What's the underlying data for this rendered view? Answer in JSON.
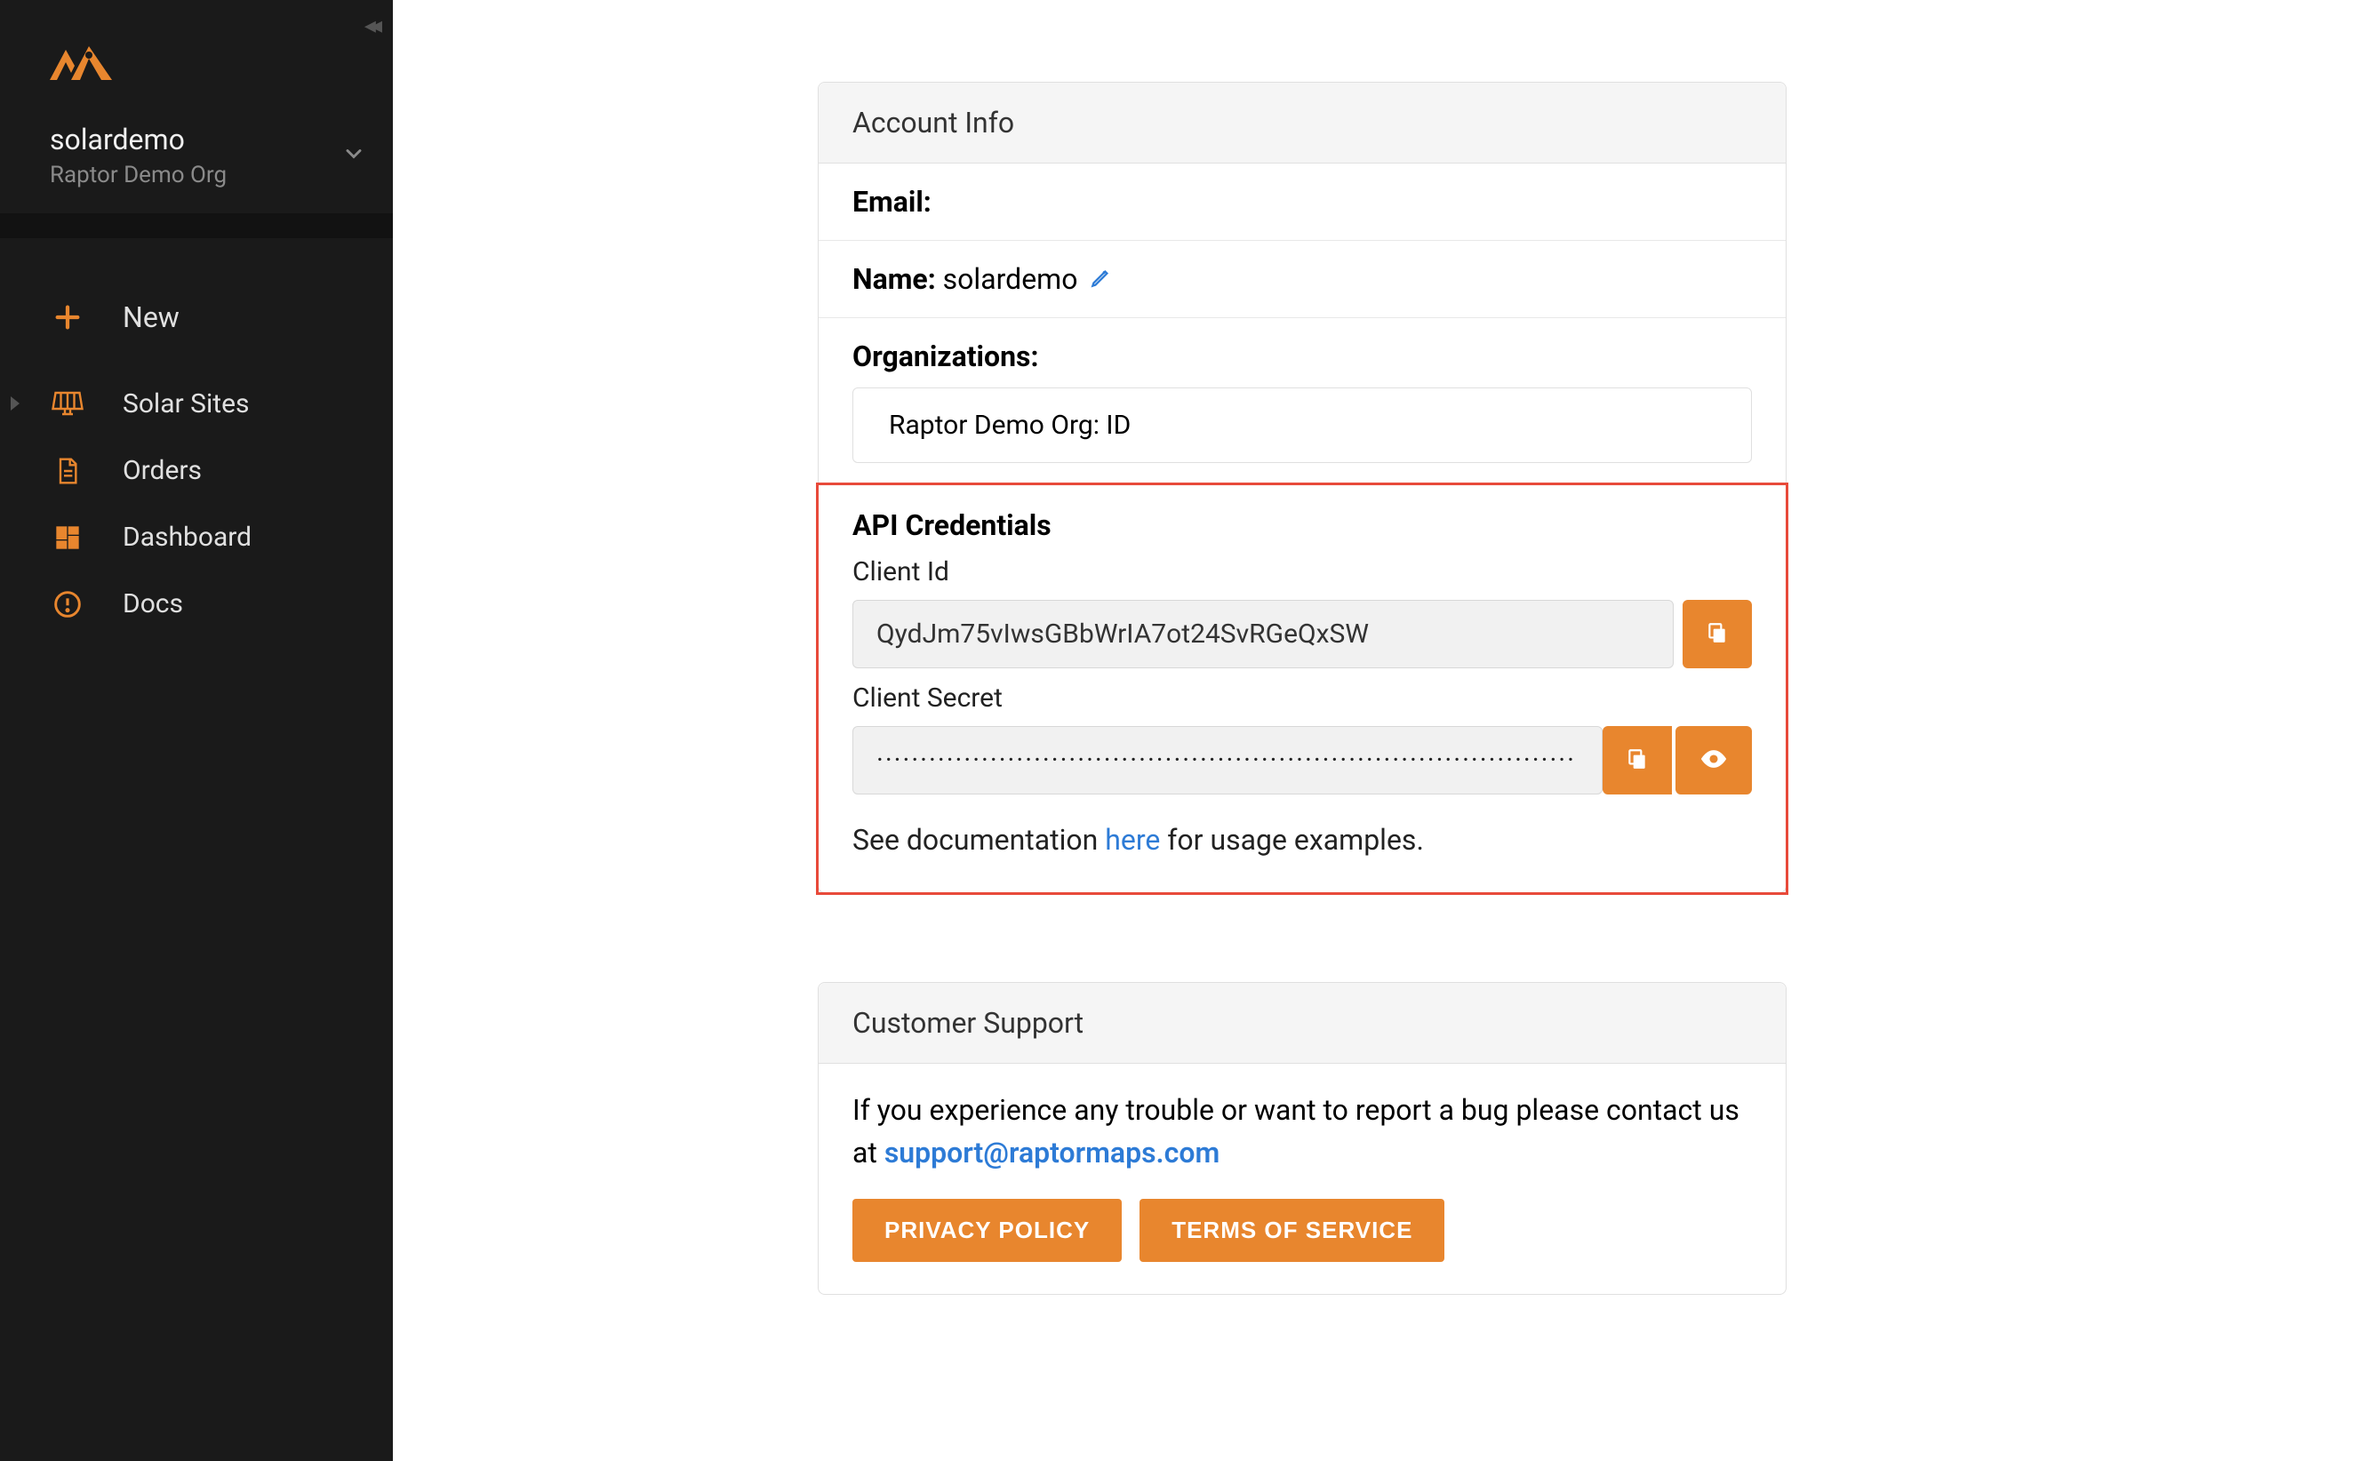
{
  "sidebar": {
    "user": "solardemo",
    "org": "Raptor Demo Org",
    "new_label": "New",
    "items": [
      {
        "label": "Solar Sites"
      },
      {
        "label": "Orders"
      },
      {
        "label": "Dashboard"
      },
      {
        "label": "Docs"
      }
    ]
  },
  "account": {
    "header": "Account Info",
    "email_label": "Email:",
    "email_value": "",
    "name_label": "Name:",
    "name_value": "solardemo",
    "orgs_label": "Organizations:",
    "org_row": "Raptor Demo Org: ID"
  },
  "api": {
    "title": "API Credentials",
    "client_id_label": "Client Id",
    "client_id_value": "QydJm75vIwsGBbWrIA7ot24SvRGeQxSW",
    "client_secret_label": "Client Secret",
    "client_secret_value": "················································································",
    "doc_prefix": "See documentation ",
    "doc_link": "here",
    "doc_suffix": " for usage examples."
  },
  "support": {
    "header": "Customer Support",
    "text_prefix": "If you experience any trouble or want to report a bug please contact us at ",
    "email": "support@raptormaps.com",
    "privacy": "PRIVACY POLICY",
    "terms": "TERMS OF SERVICE"
  }
}
